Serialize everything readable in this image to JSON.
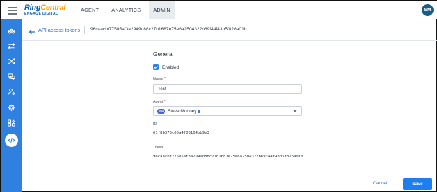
{
  "app": {
    "brand_main": "RingCentral",
    "brand_sub": "ENGAGE DIGITAL",
    "user_initials": "SM"
  },
  "nav": {
    "items": [
      {
        "label": "AGENT",
        "active": false
      },
      {
        "label": "ANALYTICS",
        "active": false
      },
      {
        "label": "ADMIN",
        "active": true
      }
    ]
  },
  "sidebar": {
    "icons": [
      {
        "name": "users-icon",
        "active": false
      },
      {
        "name": "transfer-icon",
        "active": false
      },
      {
        "name": "shuffle-icon",
        "active": false
      },
      {
        "name": "chat-icon",
        "active": false
      },
      {
        "name": "user-settings-icon",
        "active": false
      },
      {
        "name": "gear-icon",
        "active": false
      },
      {
        "name": "apps-icon",
        "active": false
      },
      {
        "name": "code-icon",
        "active": true
      }
    ]
  },
  "header": {
    "back_link": "API access tokens",
    "current": "96caacbf77585af3a2949d88c27b1687e75e6a2504322b69f44f43b5f826a01b"
  },
  "form": {
    "section_title": "General",
    "enabled_label": "Enabled",
    "enabled": true,
    "name_label": "Name",
    "name_value": "Test",
    "agent_label": "Agent",
    "agent_badge": "SM",
    "agent_name": "Steve Mooney",
    "id_label": "ID",
    "id_value": "61f8b375c65a4f00104bb9e3",
    "token_label": "Token",
    "token_value": "96caacbf77585af3a2949d88c27b1687e75e6a2504322b69f44f43b5f826a01b",
    "required_mark": "*"
  },
  "footer": {
    "cancel_label": "Cancel",
    "save_label": "Save"
  },
  "colors": {
    "accent": "#2f80df",
    "sidebar": "#2f80df",
    "save_button": "#1e7ef0",
    "link": "#2f6fbf"
  }
}
